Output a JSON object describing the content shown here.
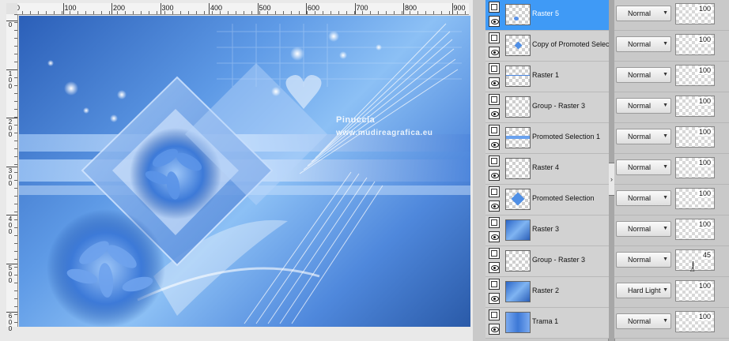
{
  "ruler": {
    "top_labels": [
      "0",
      "100",
      "200",
      "300",
      "400",
      "500",
      "600",
      "700",
      "800",
      "900"
    ],
    "left_labels": [
      "0",
      "1\n0\n0",
      "2\n0\n0",
      "3\n0\n0",
      "4\n0\n0",
      "5\n0\n0",
      "6\n0\n0"
    ]
  },
  "canvas": {
    "watermark_line1": "Pinuccia",
    "watermark_line2": "www.mudireagrafica.eu"
  },
  "layers": [
    {
      "name": "Raster 5",
      "selected": true,
      "blend": "Normal",
      "opacity": "100",
      "thumb": "checker-flower"
    },
    {
      "name": "Copy of Promoted Selection",
      "selected": false,
      "blend": "Normal",
      "opacity": "100",
      "thumb": "checker-diamond"
    },
    {
      "name": "Raster 1",
      "selected": false,
      "blend": "Normal",
      "opacity": "100",
      "thumb": "checker-line"
    },
    {
      "name": "Group - Raster 3",
      "selected": false,
      "blend": "Normal",
      "opacity": "100",
      "thumb": "checker"
    },
    {
      "name": "Promoted Selection 1",
      "selected": false,
      "blend": "Normal",
      "opacity": "100",
      "thumb": "checker-band"
    },
    {
      "name": "Raster 4",
      "selected": false,
      "blend": "Normal",
      "opacity": "100",
      "thumb": "checker"
    },
    {
      "name": "Promoted Selection",
      "selected": false,
      "blend": "Normal",
      "opacity": "100",
      "thumb": "checker-diamond-big"
    },
    {
      "name": "Raster 3",
      "selected": false,
      "blend": "Normal",
      "opacity": "100",
      "thumb": "blue"
    },
    {
      "name": "Group - Raster 3",
      "selected": false,
      "blend": "Normal",
      "opacity": "45",
      "thumb": "checker"
    },
    {
      "name": "Raster 2",
      "selected": false,
      "blend": "Hard Light",
      "opacity": "100",
      "thumb": "blue"
    },
    {
      "name": "Trama 1",
      "selected": false,
      "blend": "Normal",
      "opacity": "100",
      "thumb": "blue2"
    }
  ],
  "icons": {
    "visibility": "eye-icon",
    "mask": "layer-lock-icon",
    "dropdown": "chevron-down-icon",
    "grip": "panel-collapse-icon"
  },
  "colors": {
    "selected_row": "#3f9af6",
    "panel_bg": "#c9c9c9",
    "canvas_blue": "#5e9ae6"
  }
}
